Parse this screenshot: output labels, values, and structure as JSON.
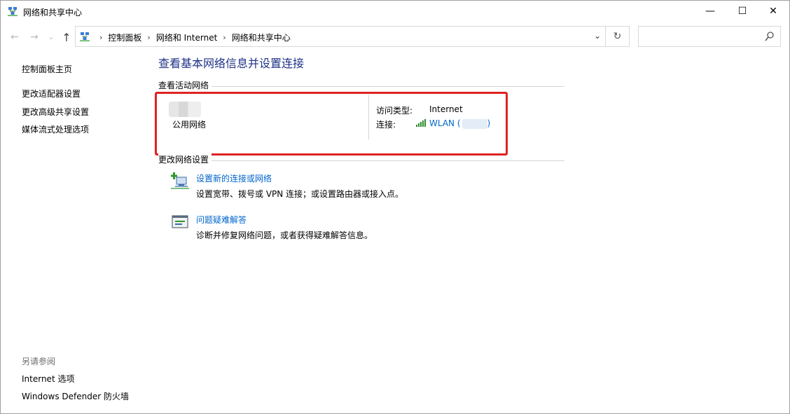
{
  "window": {
    "title": "网络和共享中心",
    "min_glyph": "—",
    "max_glyph": "☐",
    "close_glyph": "✕"
  },
  "nav": {
    "back_glyph": "←",
    "forward_glyph": "→",
    "recent_glyph": "⌄",
    "up_glyph": "↑",
    "breadcrumbs": [
      "控制面板",
      "网络和 Internet",
      "网络和共享中心"
    ],
    "crumb_sep": "›",
    "dropdown_glyph": "⌄",
    "refresh_glyph": "↻",
    "search_placeholder": ""
  },
  "sidebar": {
    "home": "控制面板主页",
    "adapter": "更改适配器设置",
    "advanced": "更改高级共享设置",
    "media": "媒体流式处理选项",
    "see_also": "另请参阅",
    "internet_options": "Internet 选项",
    "defender": "Windows Defender 防火墙"
  },
  "main": {
    "title": "查看基本网络信息并设置连接",
    "active_networks_label": "查看活动网络",
    "network_type": "公用网络",
    "access_type_label": "访问类型:",
    "access_type_value": "Internet",
    "connection_label": "连接:",
    "connection_value": "WLAN (",
    "connection_close": ")",
    "change_settings_label": "更改网络设置",
    "tasks": [
      {
        "link": "设置新的连接或网络",
        "desc": "设置宽带、拨号或 VPN 连接；或设置路由器或接入点。",
        "icon": "new-connection-icon"
      },
      {
        "link": "问题疑难解答",
        "desc": "诊断并修复网络问题，或者获得疑难解答信息。",
        "icon": "troubleshoot-icon"
      }
    ]
  },
  "colors": {
    "title_blue": "#1e3287",
    "link_blue": "#0066cc",
    "highlight_red": "#e02222"
  }
}
